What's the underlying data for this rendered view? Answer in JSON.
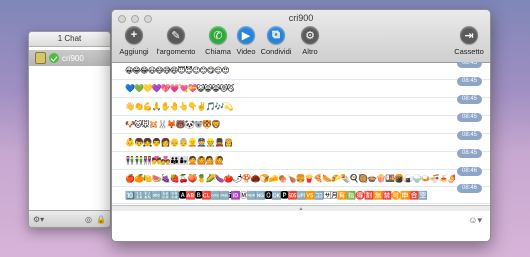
{
  "side": {
    "header": "1 Chat",
    "contact_name": "cri900"
  },
  "main": {
    "title": "cri900",
    "toolbar": [
      {
        "label": "Aggiungi",
        "icon": "plus-icon",
        "glyph": "+",
        "style": "dark"
      },
      {
        "label": "l'argomento",
        "icon": "edit-icon",
        "glyph": "✎",
        "style": "dark"
      },
      {
        "label": "Chiama",
        "icon": "phone-icon",
        "glyph": "✆",
        "style": "green"
      },
      {
        "label": "Video",
        "icon": "video-icon",
        "glyph": "▶",
        "style": "blue"
      },
      {
        "label": "Condividi",
        "icon": "share-icon",
        "glyph": "⧉",
        "style": "blue"
      },
      {
        "label": "Altro",
        "icon": "more-icon",
        "glyph": "⚙",
        "style": "dark"
      },
      {
        "label": "Cassetto",
        "icon": "drawer-icon",
        "glyph": "⇥",
        "style": "dark"
      }
    ],
    "messages": [
      {
        "text": "😀😁😂😃😄😅😆😇😈😉😊😋😌😍",
        "time": "08:45"
      },
      {
        "text": "💙💚💛💜💖💗💘💝😺😸😹😻😼",
        "time": "08:45"
      },
      {
        "text": "👋👏💪🙏✋🤚👆👇✌️🎵🎶💫",
        "time": "08:45"
      },
      {
        "text": "🐶🐱🐭🐹🐰🦊🐻🐼🐨🐯🦁",
        "time": "08:45"
      },
      {
        "text": "👶👦👧👨👩👴👵👱👮👷💂👸",
        "time": "08:45"
      },
      {
        "text": "👫👬👭💏💑👪👩‍👧🙅🙆💁🙋",
        "time": "08:45"
      },
      {
        "text": "🍎🍊🍋🍉🍇🍓🍒🍑🍍🌽🍆🍅🌶🍄🌰🍞🧀🍖🍗🍔🍟🍕🌭🌮🌯🍳🥘🍲🍿🍱🍘🍙🍚🍛🍜🍝🍠🍢🍣🍤",
        "time": "08:46"
      },
      {
        "text": "🔟🔢🔣🔤🔠🔡🅰🆎🅱🆑🆒🆓ℹ🆔Ⓜ🆕🆖🅾🆗🅿🆘🆙🆚🈁🈂🈷🈶🈯🉐🈹🈚🈲🉑🈸🈴🈳",
        "time": "08:46"
      }
    ]
  },
  "colors": {
    "timestamp_bg": "#8da5c9",
    "call_green": "#2eaa3c",
    "accent_blue": "#2b83d6"
  }
}
